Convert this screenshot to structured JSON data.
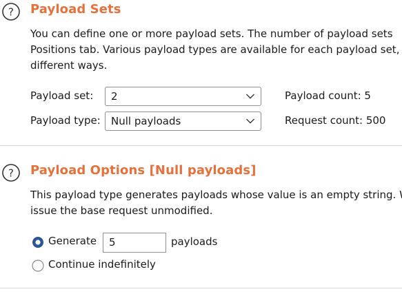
{
  "payload_sets": {
    "title": "Payload Sets",
    "description_lines": [
      "You can define one or more payload sets. The number of payload sets",
      "Positions tab. Various payload types are available for each payload set,",
      "different ways."
    ],
    "payload_set_label": "Payload set:",
    "payload_set_value": "2",
    "payload_type_label": "Payload type:",
    "payload_type_value": "Null payloads",
    "payload_count_label": "Payload count: 5",
    "request_count_label": "Request count: 500"
  },
  "payload_options": {
    "title": "Payload Options [Null payloads]",
    "description_lines": [
      "This payload type generates payloads whose value is an empty string. W",
      "issue the base request unmodified."
    ],
    "generate_label": "Generate",
    "generate_selected": true,
    "generate_value": "5",
    "payloads_suffix": "payloads",
    "continue_label": "Continue indefinitely",
    "continue_selected": false
  },
  "colors": {
    "title_accent": "#e8703a",
    "radio_selected": "#2b5797"
  },
  "icons": {
    "help": "help-question-circle-icon",
    "dropdown": "chevron-down-icon"
  }
}
